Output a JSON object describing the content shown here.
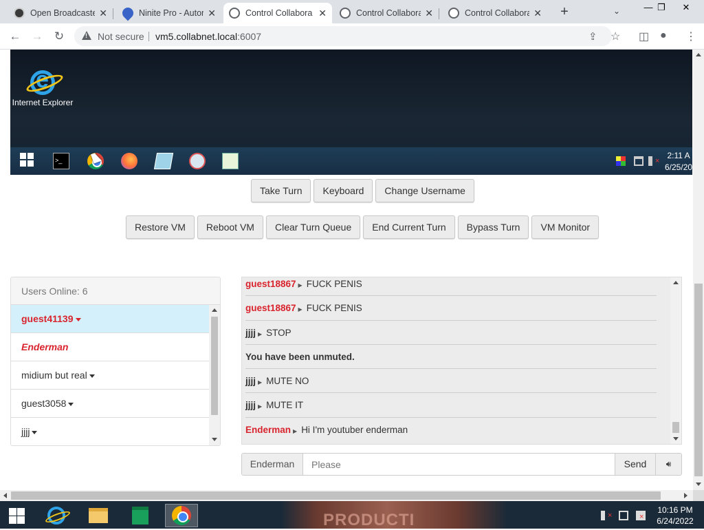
{
  "browser": {
    "tabs": [
      {
        "title": "Open Broadcaster",
        "icon": "obs-icon",
        "active": false
      },
      {
        "title": "Ninite Pro - Autom",
        "icon": "ninite-icon",
        "active": false
      },
      {
        "title": "Control Collabora",
        "icon": "globe-icon",
        "active": true
      },
      {
        "title": "Control Collabora",
        "icon": "globe-icon",
        "active": false
      },
      {
        "title": "Control Collabora",
        "icon": "globe-icon",
        "active": false
      }
    ],
    "new_tab": "+",
    "security_label": "Not secure",
    "url_host": "vm5.collabnet.local",
    "url_port": ":6007"
  },
  "vm_screen": {
    "desktop_icon_label": "Internet Explorer",
    "clock_time": "2:11 A",
    "clock_date": "6/25/20",
    "taskbar_apps": [
      "start-icon",
      "terminal-icon",
      "chrome-icon",
      "firefox-icon",
      "notepad-icon",
      "paint-icon",
      "chart-icon"
    ]
  },
  "controls": {
    "take_turn": "Take Turn",
    "keyboard": "Keyboard",
    "change_username": "Change Username",
    "restore_vm": "Restore VM",
    "reboot_vm": "Reboot VM",
    "clear_turn_queue": "Clear Turn Queue",
    "end_current_turn": "End Current Turn",
    "bypass_turn": "Bypass Turn",
    "vm_monitor": "VM Monitor"
  },
  "users": {
    "header": "Users Online: 6",
    "list": [
      {
        "name": "guest41139",
        "style": "me",
        "caret": true
      },
      {
        "name": "Enderman",
        "style": "admin",
        "caret": false
      },
      {
        "name": "midium but real",
        "style": "normal",
        "caret": true
      },
      {
        "name": "guest3058",
        "style": "normal",
        "caret": true
      },
      {
        "name": "jjjj",
        "style": "normal",
        "caret": true
      }
    ]
  },
  "chat": {
    "messages": [
      {
        "user": "guest18867",
        "text": "FUCK PENIS",
        "user_color": "red"
      },
      {
        "user": "guest18867",
        "text": "FUCK PENIS",
        "user_color": "red"
      },
      {
        "user": "jjjj",
        "text": "STOP",
        "user_color": "plain"
      },
      {
        "user": "",
        "text": "You have been unmuted.",
        "user_color": "system"
      },
      {
        "user": "jjjj",
        "text": "MUTE NO",
        "user_color": "plain"
      },
      {
        "user": "jjjj",
        "text": "MUTE IT",
        "user_color": "plain"
      },
      {
        "user": "Enderman",
        "text": "Hi I'm youtuber enderman",
        "user_color": "red"
      }
    ],
    "nickname": "Enderman",
    "input_placeholder": "Please",
    "send_label": "Send"
  },
  "os_taskbar": {
    "clock_time": "10:16 PM",
    "clock_date": "6/24/2022",
    "promo_text": "PRODUCTI"
  },
  "colors": {
    "accent_red": "#d9232d",
    "selected_user_bg": "#d4f0fb",
    "chat_bg": "#ececec"
  }
}
